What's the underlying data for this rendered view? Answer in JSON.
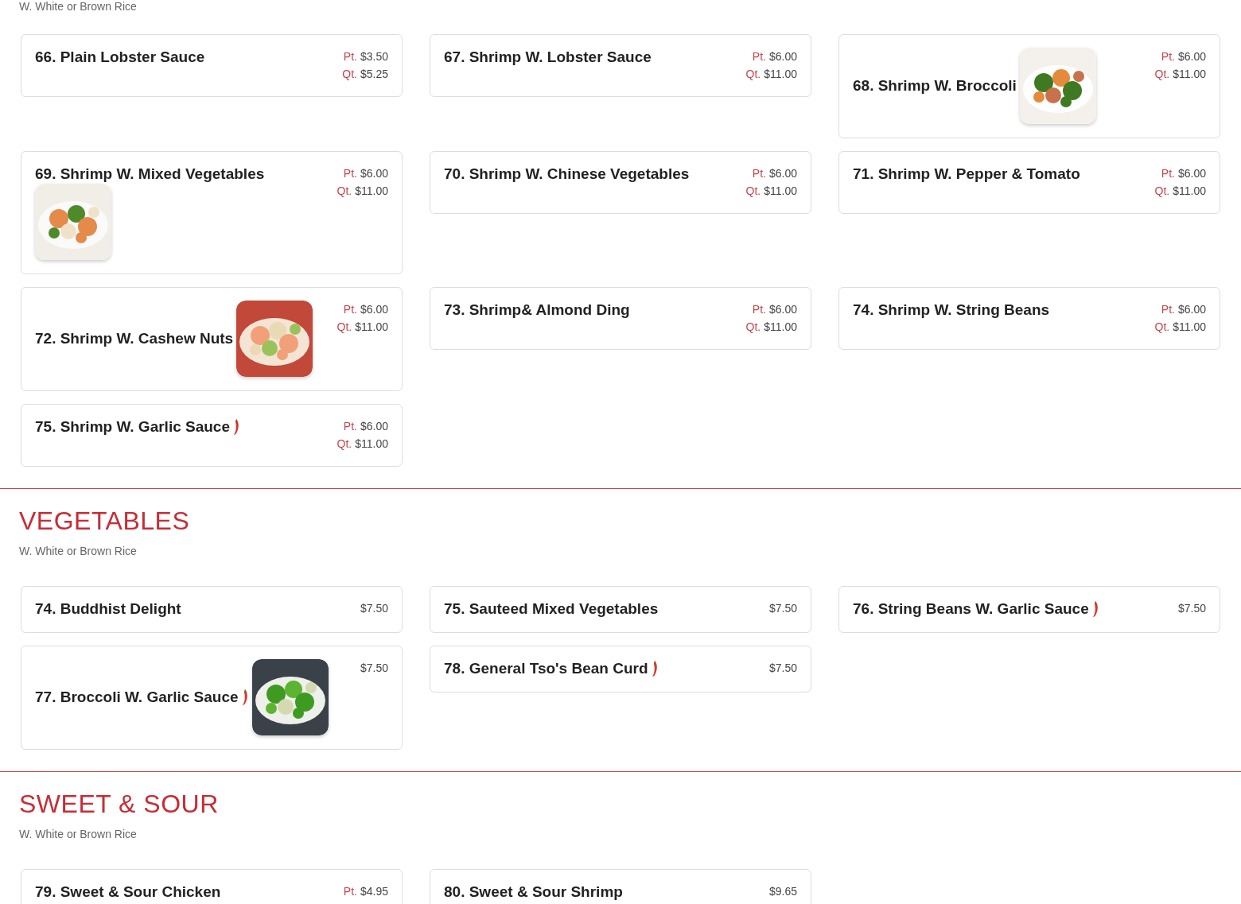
{
  "sections": [
    {
      "subtitle": "W. White or Brown Rice",
      "items": [
        {
          "name": "66. Plain Lobster Sauce",
          "kind": "plain",
          "spicy": false,
          "prices": [
            {
              "label": "Pt.",
              "amount": "$3.50"
            },
            {
              "label": "Qt.",
              "amount": "$5.25"
            }
          ]
        },
        {
          "name": "67. Shrimp W. Lobster Sauce",
          "kind": "plain",
          "spicy": false,
          "prices": [
            {
              "label": "Pt.",
              "amount": "$6.00"
            },
            {
              "label": "Qt.",
              "amount": "$11.00"
            }
          ]
        },
        {
          "name": "68. Shrimp W. Broccoli",
          "kind": "picture-beside",
          "spicy": false,
          "prices": [
            {
              "label": "Pt.",
              "amount": "$6.00"
            },
            {
              "label": "Qt.",
              "amount": "$11.00"
            }
          ]
        },
        {
          "name": "69. Shrimp W. Mixed Vegetables",
          "kind": "picture-below",
          "spicy": false,
          "prices": [
            {
              "label": "Pt.",
              "amount": "$6.00"
            },
            {
              "label": "Qt.",
              "amount": "$11.00"
            }
          ]
        },
        {
          "name": "70. Shrimp W. Chinese Vegetables",
          "kind": "plain",
          "spicy": false,
          "prices": [
            {
              "label": "Pt.",
              "amount": "$6.00"
            },
            {
              "label": "Qt.",
              "amount": "$11.00"
            }
          ]
        },
        {
          "name": "71. Shrimp W. Pepper & Tomato",
          "kind": "plain",
          "spicy": false,
          "prices": [
            {
              "label": "Pt.",
              "amount": "$6.00"
            },
            {
              "label": "Qt.",
              "amount": "$11.00"
            }
          ]
        },
        {
          "name": "72. Shrimp W. Cashew Nuts",
          "kind": "picture-beside",
          "spicy": false,
          "prices": [
            {
              "label": "Pt.",
              "amount": "$6.00"
            },
            {
              "label": "Qt.",
              "amount": "$11.00"
            }
          ]
        },
        {
          "name": "73. Shrimp& Almond Ding",
          "kind": "plain",
          "spicy": false,
          "prices": [
            {
              "label": "Pt.",
              "amount": "$6.00"
            },
            {
              "label": "Qt.",
              "amount": "$11.00"
            }
          ]
        },
        {
          "name": "74. Shrimp W. String Beans",
          "kind": "plain",
          "spicy": false,
          "prices": [
            {
              "label": "Pt.",
              "amount": "$6.00"
            },
            {
              "label": "Qt.",
              "amount": "$11.00"
            }
          ]
        },
        {
          "name": "75. Shrimp W. Garlic Sauce",
          "kind": "plain",
          "spicy": true,
          "prices": [
            {
              "label": "Pt.",
              "amount": "$6.00"
            },
            {
              "label": "Qt.",
              "amount": "$11.00"
            }
          ]
        }
      ]
    },
    {
      "title": "VEGETABLES",
      "subtitle": "W. White or Brown Rice",
      "items": [
        {
          "name": "74. Buddhist Delight",
          "kind": "plain",
          "spicy": false,
          "prices": [
            {
              "amount": "$7.50"
            }
          ]
        },
        {
          "name": "75. Sauteed Mixed Vegetables",
          "kind": "plain",
          "spicy": false,
          "prices": [
            {
              "amount": "$7.50"
            }
          ]
        },
        {
          "name": "76. String Beans W. Garlic Sauce",
          "kind": "plain",
          "spicy": true,
          "prices": [
            {
              "amount": "$7.50"
            }
          ]
        },
        {
          "name": "77. Broccoli W. Garlic Sauce",
          "kind": "picture-beside",
          "spicy": true,
          "prices": [
            {
              "amount": "$7.50"
            }
          ]
        },
        {
          "name": "78. General Tso's Bean Curd",
          "kind": "plain",
          "spicy": true,
          "prices": [
            {
              "amount": "$7.50"
            }
          ]
        }
      ]
    },
    {
      "title": "SWEET & SOUR",
      "subtitle": "W. White or Brown Rice",
      "items": [
        {
          "name": "79. Sweet & Sour Chicken",
          "kind": "plain",
          "spicy": false,
          "prices": [
            {
              "label": "Pt.",
              "amount": "$4.95"
            }
          ]
        },
        {
          "name": "80. Sweet & Sour Shrimp",
          "kind": "plain",
          "spicy": false,
          "prices": [
            {
              "amount": "$9.65"
            }
          ]
        }
      ]
    }
  ]
}
